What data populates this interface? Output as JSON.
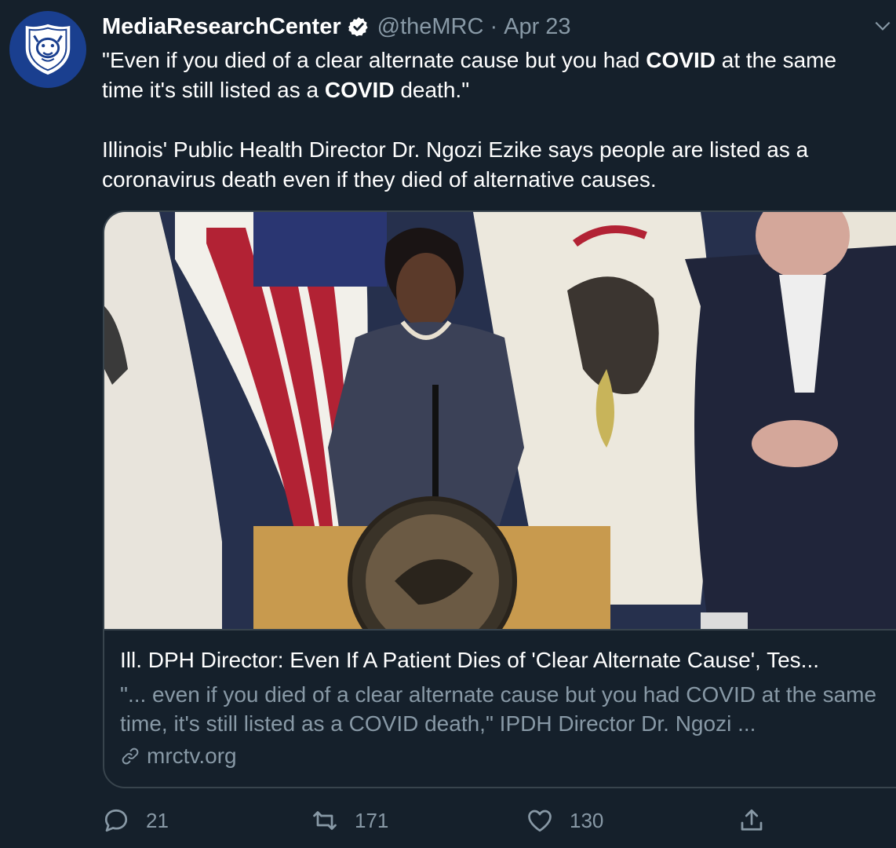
{
  "author": {
    "name": "MediaResearchCenter",
    "handle": "@theMRC",
    "separator": "·",
    "date": "Apr 23"
  },
  "tweet": {
    "quote_part1": "\"Even if you died of a clear alternate cause but you had ",
    "quote_bold1": "COVID",
    "quote_part2": " at the same time it's still listed as a ",
    "quote_bold2": "COVID",
    "quote_part3": " death.\"",
    "paragraph2": "Illinois' Public Health Director Dr. Ngozi Ezike says people are listed as a coronavirus death even if they died of alternative causes."
  },
  "card": {
    "title": "Ill. DPH Director: Even If A Patient Dies of 'Clear Alternate Cause', Tes...",
    "description": "\"... even if you died of a clear alternate cause but you had COVID at the same time, it's still listed as a COVID death,\" IPDH Director Dr. Ngozi ...",
    "domain": "mrctv.org"
  },
  "actions": {
    "replies": "21",
    "retweets": "171",
    "likes": "130"
  },
  "icons": {
    "avatar": "bulldog-shield-logo",
    "verified": "verified-badge-icon",
    "menu": "chevron-down-icon",
    "link": "link-icon",
    "reply": "reply-icon",
    "retweet": "retweet-icon",
    "like": "heart-icon",
    "share": "share-icon"
  },
  "colors": {
    "background": "#15202b",
    "secondary_text": "#8899a6",
    "border": "#38444d",
    "avatar_bg": "#1a3f8f"
  }
}
